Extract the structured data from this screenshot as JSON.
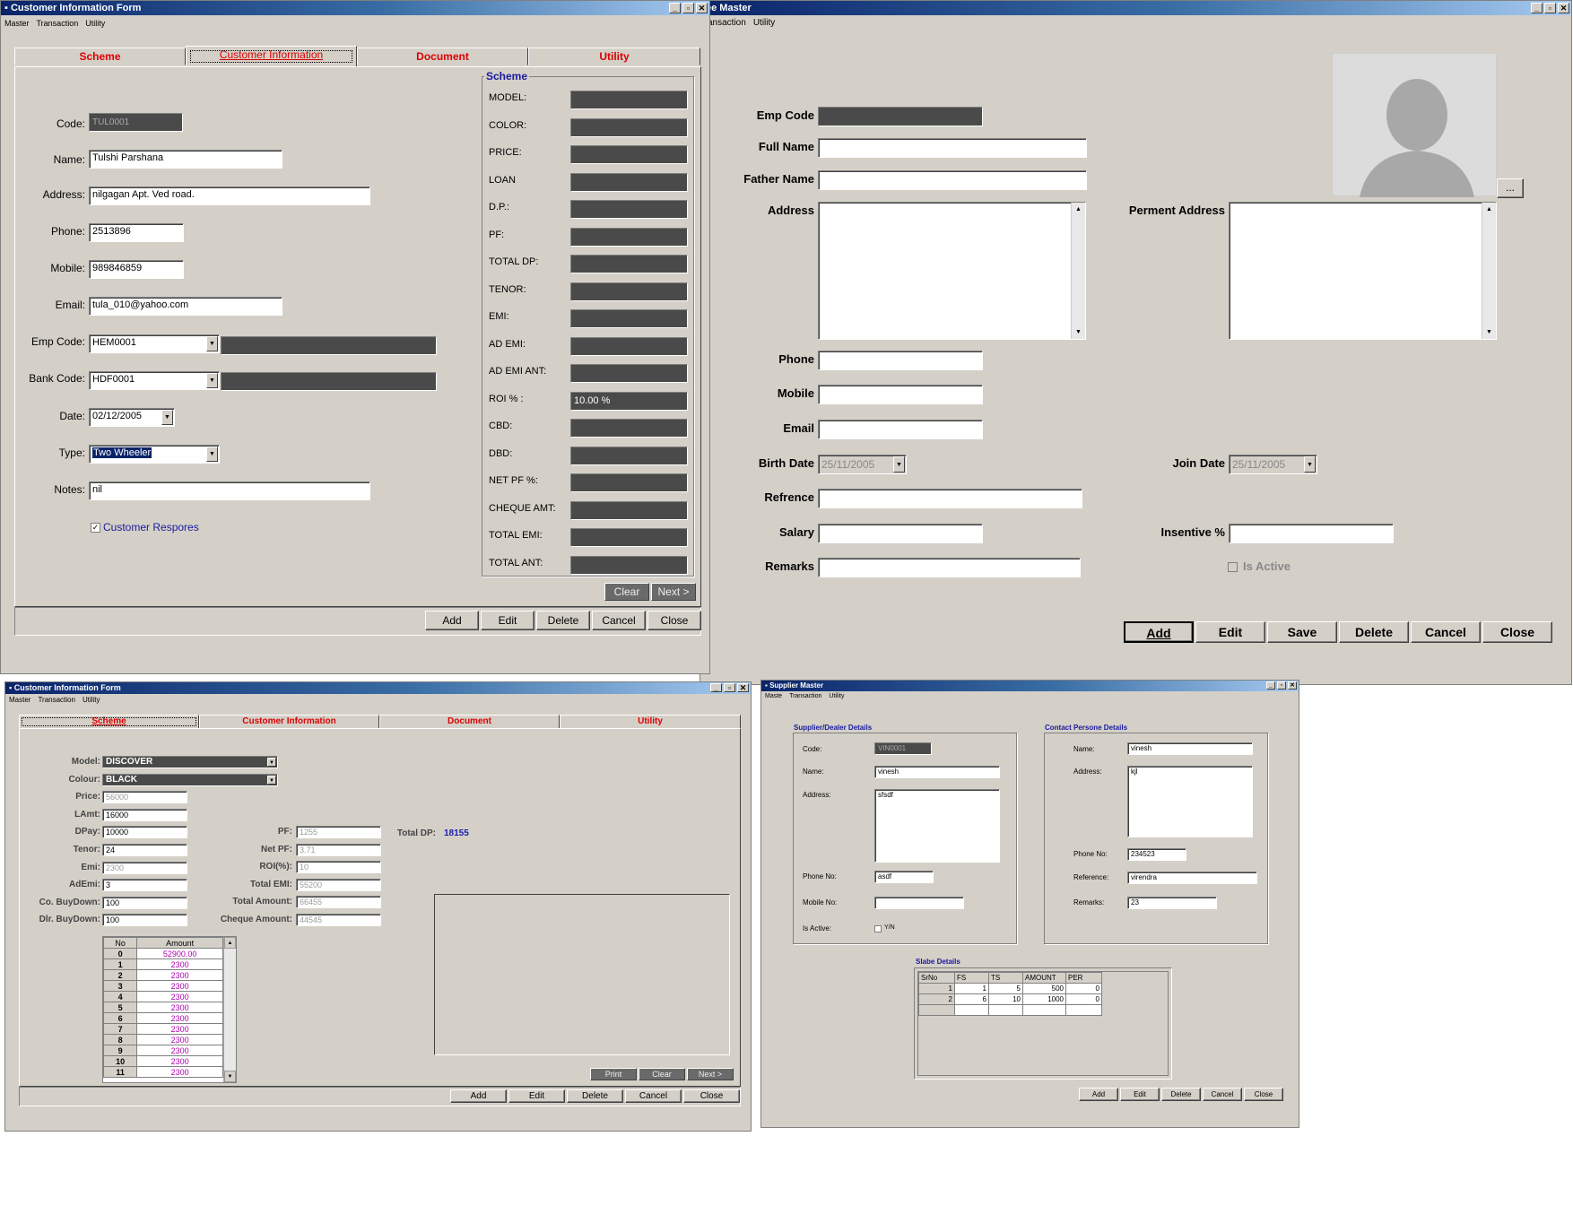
{
  "w1": {
    "title": "Customer Information Form",
    "menu": [
      "Master",
      "Transaction",
      "Utility"
    ],
    "tabs": [
      "Scheme",
      "Customer Information",
      "Document",
      "Utility"
    ],
    "fields": {
      "code_label": "Code:",
      "code": "TUL0001",
      "name_label": "Name:",
      "name": "Tulshi Parshana",
      "address_label": "Address:",
      "address": "nilgagan Apt. Ved road.",
      "phone_label": "Phone:",
      "phone": "2513896",
      "mobile_label": "Mobile:",
      "mobile": "989846859",
      "email_label": "Email:",
      "email": "tula_010@yahoo.com",
      "empcode_label": "Emp Code:",
      "empcode": "HEM0001",
      "bankcode_label": "Bank Code:",
      "bankcode": "HDF0001",
      "date_label": "Date:",
      "date": "02/12/2005",
      "type_label": "Type:",
      "type": "Two Wheeler",
      "notes_label": "Notes:",
      "notes": "nil",
      "response_label": "Customer Respores"
    },
    "scheme_title": "Scheme",
    "scheme_labels": [
      "MODEL:",
      "COLOR:",
      "PRICE:",
      "LOAN",
      "D.P.:",
      "PF:",
      "TOTAL DP:",
      "TENOR:",
      "EMI:",
      "AD EMI:",
      "AD EMI ANT:",
      "ROI % :",
      "CBD:",
      "DBD:",
      "NET PF %:",
      "CHEQUE AMT:",
      "TOTAL EMI:",
      "TOTAL ANT:"
    ],
    "roi_value": "10.00 %",
    "clear": "Clear",
    "next": "Next >",
    "buttons": [
      "Add",
      "Edit",
      "Delete",
      "Cancel",
      "Close"
    ]
  },
  "w2": {
    "title": "ee Master",
    "menu": [
      "ansaction",
      "Utility"
    ],
    "emp_code": "Emp Code",
    "full_name": "Full Name",
    "father_name": "Father Name",
    "address": "Address",
    "perm_address": "Perment Address",
    "phone": "Phone",
    "mobile": "Mobile",
    "email": "Email",
    "birth_date": "Birth Date",
    "birth_date_val": "25/11/2005",
    "join_date": "Join Date",
    "join_date_val": "25/11/2005",
    "refrence": "Refrence",
    "salary": "Salary",
    "insentive": "Insentive %",
    "remarks": "Remarks",
    "is_active": "Is Active",
    "browse": "...",
    "buttons": [
      "Add",
      "Edit",
      "Save",
      "Delete",
      "Cancel",
      "Close"
    ]
  },
  "w3": {
    "title": "Customer Information Form",
    "menu": [
      "Master",
      "Transaction",
      "Utility"
    ],
    "tabs": [
      "Scheme",
      "Customer Information",
      "Document",
      "Utility"
    ],
    "left": [
      {
        "label": "Model:",
        "value": "DISCOVER"
      },
      {
        "label": "Colour:",
        "value": "BLACK"
      },
      {
        "label": "Price:",
        "value": "56000"
      },
      {
        "label": "LAmt:",
        "value": "16000"
      },
      {
        "label": "DPay:",
        "value": "10000"
      },
      {
        "label": "Tenor:",
        "value": "24"
      },
      {
        "label": "Emi:",
        "value": "2300"
      },
      {
        "label": "AdEmi:",
        "value": "3"
      },
      {
        "label": "Co. BuyDown:",
        "value": "100"
      },
      {
        "label": "Dlr. BuyDown:",
        "value": "100"
      }
    ],
    "mid": [
      {
        "label": "PF:",
        "value": "1255"
      },
      {
        "label": "Net PF:",
        "value": "3.71"
      },
      {
        "label": "ROI(%):",
        "value": "10"
      },
      {
        "label": "Total EMI:",
        "value": "55200"
      },
      {
        "label": "Total Amount:",
        "value": "66455"
      },
      {
        "label": "Cheque Amount:",
        "value": "44545"
      }
    ],
    "total_dp_label": "Total DP:",
    "total_dp": "18155",
    "grid_headers": [
      "No",
      "Amount"
    ],
    "grid_rows": [
      [
        "0",
        "52900.00"
      ],
      [
        "1",
        "2300"
      ],
      [
        "2",
        "2300"
      ],
      [
        "3",
        "2300"
      ],
      [
        "4",
        "2300"
      ],
      [
        "5",
        "2300"
      ],
      [
        "6",
        "2300"
      ],
      [
        "7",
        "2300"
      ],
      [
        "8",
        "2300"
      ],
      [
        "9",
        "2300"
      ],
      [
        "10",
        "2300"
      ],
      [
        "11",
        "2300"
      ]
    ],
    "print": "Print",
    "clear": "Clear",
    "next": "Next >",
    "buttons": [
      "Add",
      "Edit",
      "Delete",
      "Cancel",
      "Close"
    ]
  },
  "w4": {
    "title": "Supplier Master",
    "menu": [
      "Maste",
      "Transaction",
      "Utility"
    ],
    "supplier_group": "Supplier/Dealer Details",
    "code_label": "Code:",
    "code": "VIN0001",
    "name_label": "Name:",
    "name": "vinesh",
    "address_label": "Address:",
    "address": "sfsdf",
    "phone_label": "Phone No:",
    "phone": "asdf",
    "mobile_label": "Mobile No:",
    "active_label": "Is Active:",
    "yn": "Y/N",
    "contact_group": "Contact Persone Details",
    "c_name_label": "Name:",
    "c_name": "vinesh",
    "c_address_label": "Address:",
    "c_address": "kjl",
    "c_phone_label": "Phone No:",
    "c_phone": "234523",
    "c_ref_label": "Reference:",
    "c_ref": "virendra",
    "c_remarks_label": "Remarks:",
    "c_remarks": "23",
    "slabe_group": "Slabe Details",
    "slabe_headers": [
      "SrNo",
      "FS",
      "TS",
      "AMOUNT",
      "PER"
    ],
    "slabe_rows": [
      [
        "1",
        "1",
        "5",
        "500",
        "0"
      ],
      [
        "2",
        "6",
        "10",
        "1000",
        "0"
      ]
    ],
    "buttons": [
      "Add",
      "Edit",
      "Delete",
      "Cancel",
      "Close"
    ]
  }
}
